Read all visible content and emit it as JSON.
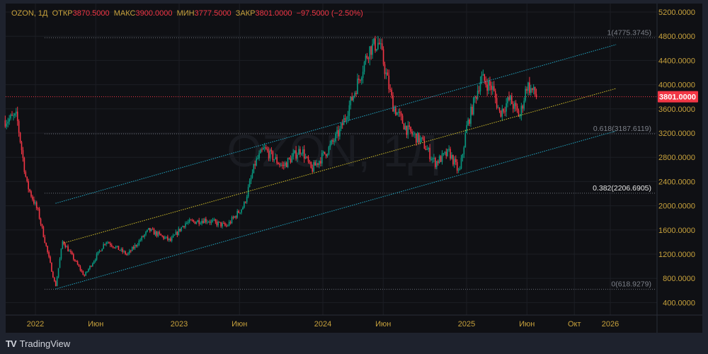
{
  "legend": {
    "symbol": "OZON, 1Д",
    "open_label": "ОТКР",
    "open": "3870.5000",
    "high_label": "МАКС",
    "high": "3900.0000",
    "low_label": "МИН",
    "low": "3777.5000",
    "close_label": "ЗАКР",
    "close": "3801.0000",
    "change": "−97.5000 (−2.50%)"
  },
  "watermark": "OZON, 1Д",
  "footer": {
    "brand": "TradingView"
  },
  "colors": {
    "up": "#089981",
    "down": "#f23645",
    "axis_text": "#c8a23c",
    "channel": "#22a7c4",
    "midline": "#d4c02a",
    "last_price": "#f23645"
  },
  "chart_data": {
    "type": "candlestick",
    "title": "OZON, 1Д",
    "last_price": 3801,
    "last_price_label": "3801.0000",
    "ylim": [
      300,
      5250
    ],
    "y_ticks": [
      "5200.0000",
      "4800.0000",
      "4400.0000",
      "4000.0000",
      "3600.0000",
      "3200.0000",
      "2800.0000",
      "2400.0000",
      "2000.0000",
      "1600.0000",
      "1200.0000",
      "800.0000",
      "400.0000"
    ],
    "y_tick_values": [
      5200,
      4800,
      4400,
      4000,
      3600,
      3200,
      2800,
      2400,
      2000,
      1600,
      1200,
      800,
      400
    ],
    "x_ticks": [
      {
        "label": "2022",
        "t": 2022.0
      },
      {
        "label": "Июн",
        "t": 2022.42
      },
      {
        "label": "2023",
        "t": 2023.0
      },
      {
        "label": "Июн",
        "t": 2023.42
      },
      {
        "label": "2024",
        "t": 2024.0
      },
      {
        "label": "Июн",
        "t": 2024.42
      },
      {
        "label": "2025",
        "t": 2025.0
      },
      {
        "label": "Июн",
        "t": 2025.42
      },
      {
        "label": "Окт",
        "t": 2025.75
      },
      {
        "label": "2026",
        "t": 2026.0
      }
    ],
    "price_path": [
      [
        2021.79,
        3410
      ],
      [
        2021.87,
        3470
      ],
      [
        2021.94,
        2360
      ],
      [
        2022.02,
        1890
      ],
      [
        2022.14,
        660
      ],
      [
        2022.19,
        1420
      ],
      [
        2022.34,
        840
      ],
      [
        2022.49,
        1420
      ],
      [
        2022.64,
        1190
      ],
      [
        2022.79,
        1600
      ],
      [
        2022.94,
        1420
      ],
      [
        2023.04,
        1710
      ],
      [
        2023.18,
        1770
      ],
      [
        2023.33,
        1660
      ],
      [
        2023.45,
        2000
      ],
      [
        2023.53,
        2710
      ],
      [
        2023.59,
        2940
      ],
      [
        2023.72,
        2650
      ],
      [
        2023.85,
        2940
      ],
      [
        2023.92,
        2590
      ],
      [
        2024.04,
        2940
      ],
      [
        2024.12,
        3240
      ],
      [
        2024.22,
        3880
      ],
      [
        2024.32,
        4580
      ],
      [
        2024.39,
        4700
      ],
      [
        2024.49,
        3640
      ],
      [
        2024.59,
        3240
      ],
      [
        2024.69,
        3060
      ],
      [
        2024.78,
        2710
      ],
      [
        2024.88,
        2880
      ],
      [
        2024.95,
        2530
      ],
      [
        2025.0,
        3290
      ],
      [
        2025.1,
        4110
      ],
      [
        2025.18,
        3940
      ],
      [
        2025.23,
        3530
      ],
      [
        2025.3,
        3760
      ],
      [
        2025.37,
        3470
      ],
      [
        2025.42,
        4000
      ],
      [
        2025.49,
        3801
      ]
    ],
    "fib_levels": [
      {
        "label": "1(4775.3745)",
        "value": 4775.3745
      },
      {
        "label": "0.618(3187.6119)",
        "value": 3187.6119
      },
      {
        "label": "0.382(2206.6905)",
        "value": 2206.6905
      },
      {
        "label": "0(618.9279)",
        "value": 618.9279
      }
    ],
    "channel": [
      {
        "name": "upper",
        "from": [
          2022.14,
          2040
        ],
        "to": [
          2026.04,
          4662
        ]
      },
      {
        "name": "middle",
        "from": [
          2022.2,
          1387
        ],
        "to": [
          2026.04,
          3937
        ]
      },
      {
        "name": "lower",
        "from": [
          2022.14,
          625
        ],
        "to": [
          2026.04,
          3235
        ]
      }
    ]
  }
}
